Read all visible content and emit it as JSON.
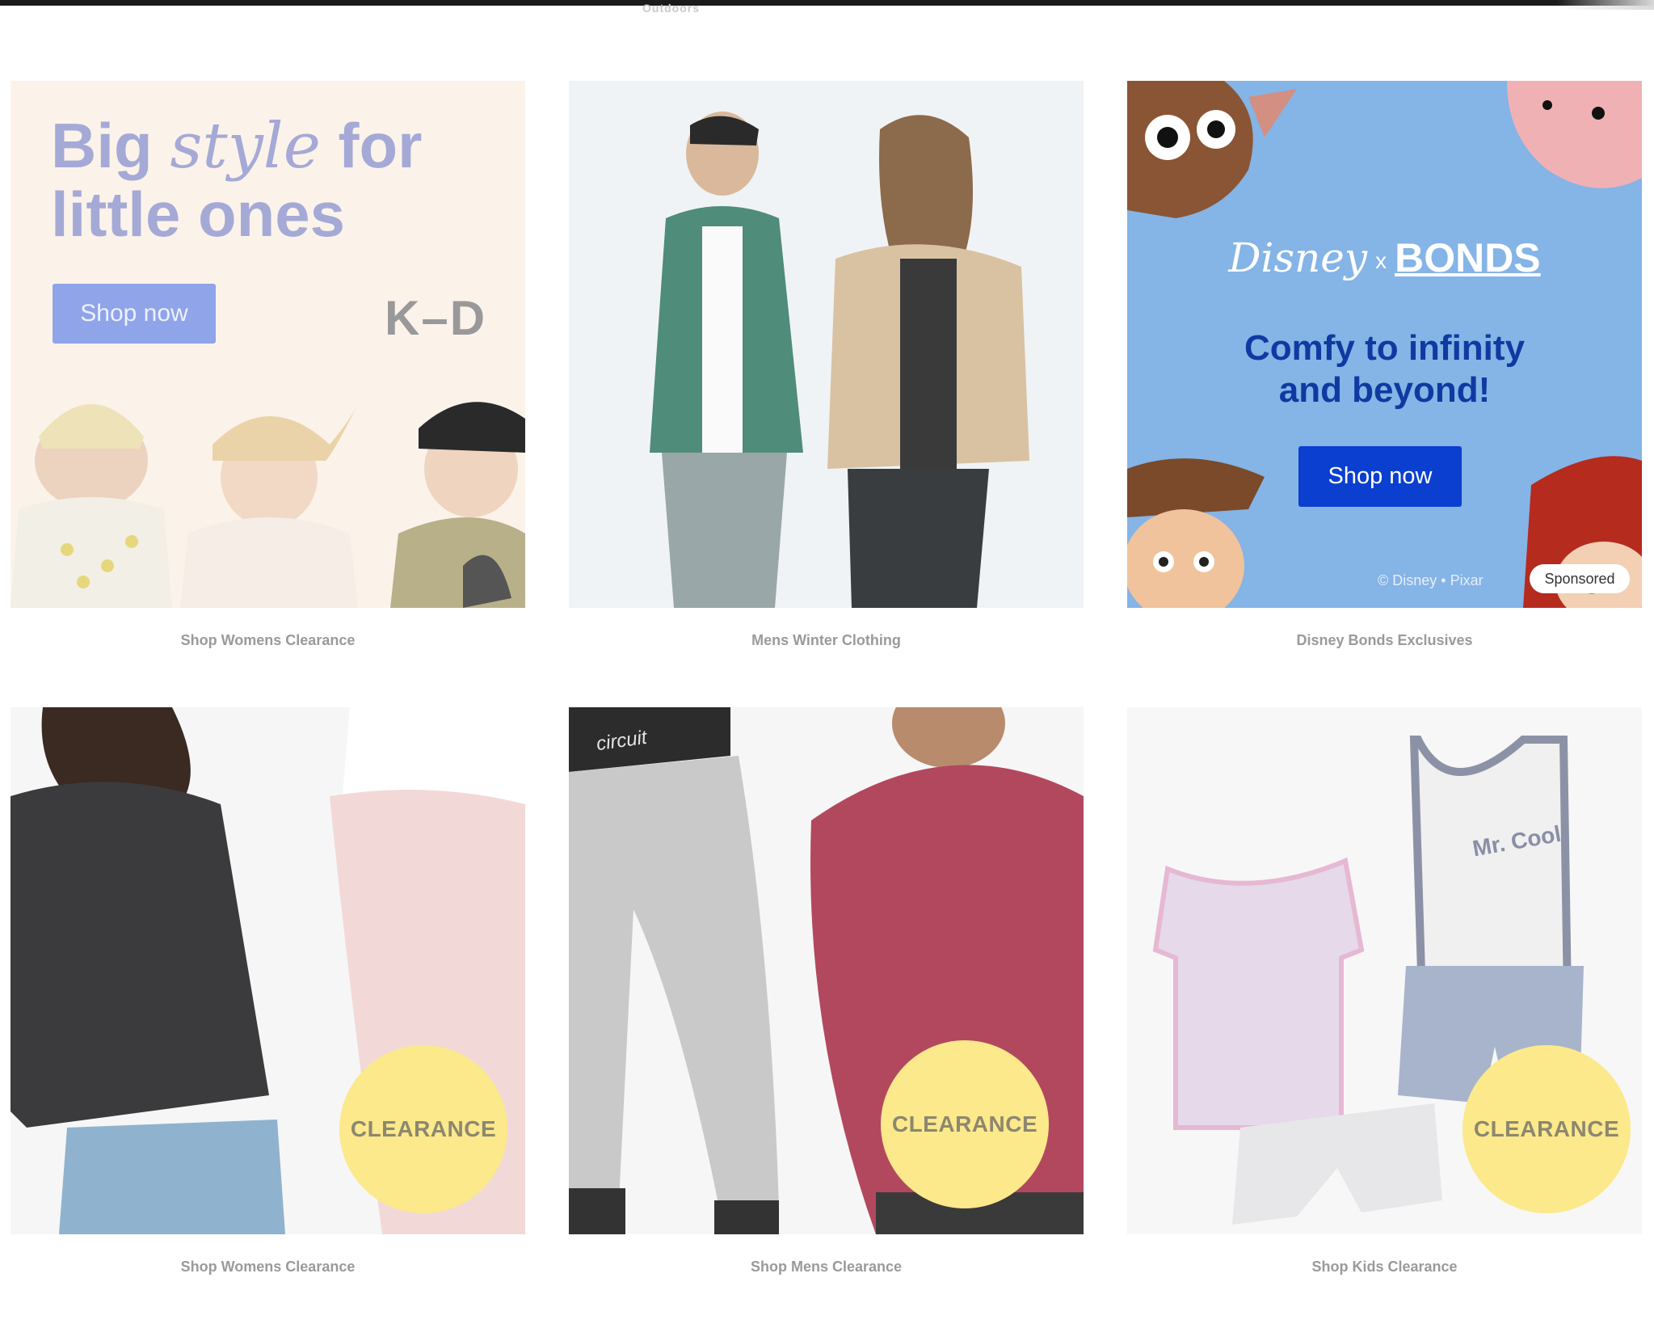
{
  "page": {
    "ghost_text": "Outdoors"
  },
  "tiles": [
    {
      "headline_part1": "Big",
      "headline_script": "style",
      "headline_part2": "for",
      "headline_line2": "little ones",
      "button_label": "Shop now",
      "logo_text": "K–D",
      "caption": "Shop Womens Clearance"
    },
    {
      "caption": "Mens Winter Clothing"
    },
    {
      "brand_left": "Disney",
      "brand_separator": "x",
      "brand_right": "BONDS",
      "tagline_line1": "Comfy to infinity",
      "tagline_line2": "and beyond!",
      "button_label": "Shop now",
      "copyright": "© Disney • Pixar",
      "sponsored_label": "Sponsored",
      "caption": "Disney Bonds Exclusives"
    },
    {
      "badge": "CLEARANCE",
      "caption": "Shop Womens Clearance"
    },
    {
      "badge": "CLEARANCE",
      "waistband_text": "circuit",
      "caption": "Shop Mens Clearance"
    },
    {
      "badge": "CLEARANCE",
      "shirt_text": "Mr. Cool",
      "caption": "Shop Kids Clearance"
    }
  ],
  "colors": {
    "top_bar": "#1b1b1b",
    "kd_background": "#fbf3ea",
    "kd_button": "#8fa4e9",
    "bonds_background": "#85b4e6",
    "bonds_button": "#0a3fcf",
    "clearance_badge": "#fbe98b",
    "caption_text": "#9a9a9a"
  }
}
